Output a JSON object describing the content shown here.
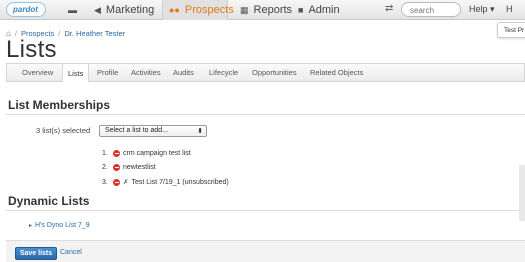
{
  "nav": {
    "logo_text": "pardot",
    "items": [
      {
        "label": "",
        "icon": "folder-icon"
      },
      {
        "label": "Marketing",
        "icon": "megaphone-icon"
      },
      {
        "label": "Prospects",
        "icon": "people-icon",
        "active": true
      },
      {
        "label": "Reports",
        "icon": "chart-icon"
      },
      {
        "label": "Admin",
        "icon": "briefcase-icon"
      }
    ],
    "search_placeholder": "search",
    "help_label": "Help",
    "user_initial": "H"
  },
  "breadcrumb": {
    "items": [
      "Prospects",
      "Dr. Heather Tester"
    ],
    "separator": "/"
  },
  "page_title": "Lists",
  "test_box": "Test Pr",
  "tabs": [
    "Overview",
    "Lists",
    "Profile",
    "Activities",
    "Audits",
    "Lifecycle",
    "Opportunities",
    "Related Objects"
  ],
  "active_tab": "Lists",
  "list_memberships": {
    "title": "List Memberships",
    "selected_label": "3 list(s) selected",
    "select_value": "Select a list to add...",
    "lists": [
      {
        "num": "1.",
        "name": "crm campaign test list",
        "x": false
      },
      {
        "num": "2.",
        "name": "newtestlist",
        "x": false
      },
      {
        "num": "3.",
        "name": "Test List 7/19_1 (unsubscribed)",
        "x": true
      }
    ]
  },
  "dynamic_lists": {
    "title": "Dynamic Lists",
    "items": [
      "H's Dyno List 7_9"
    ]
  },
  "footer": {
    "save_label": "Save lists",
    "cancel_label": "Cancel"
  },
  "colors": {
    "accent": "#e27a1a",
    "link": "#2a6aa8",
    "button": "#2b68ad",
    "remove": "#d9342b"
  }
}
